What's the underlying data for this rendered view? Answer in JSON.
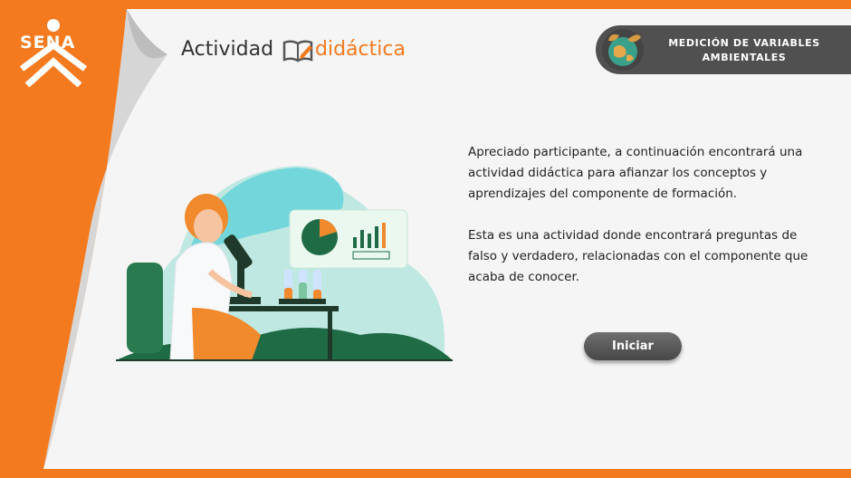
{
  "brand": {
    "logo_text": "SENA"
  },
  "header": {
    "title_word": "Actividad",
    "title_accent": "didáctica"
  },
  "badge": {
    "line1": "MEDICIÓN DE VARIABLES",
    "line2": "AMBIENTALES",
    "icon": "earth-leaves-icon"
  },
  "content": {
    "paragraph1": "Apreciado participante, a continuación encontrará una actividad didáctica para afianzar los conceptos y aprendizajes del componente de formación.",
    "paragraph2": "Esta es una actividad donde encontrará preguntas de falso y verdadero, relacionadas con el componente que acaba de conocer."
  },
  "actions": {
    "start_label": "Iniciar"
  },
  "colors": {
    "brand_orange": "#f47a1f",
    "badge_gray": "#505050",
    "plant_green": "#1f6b45"
  }
}
